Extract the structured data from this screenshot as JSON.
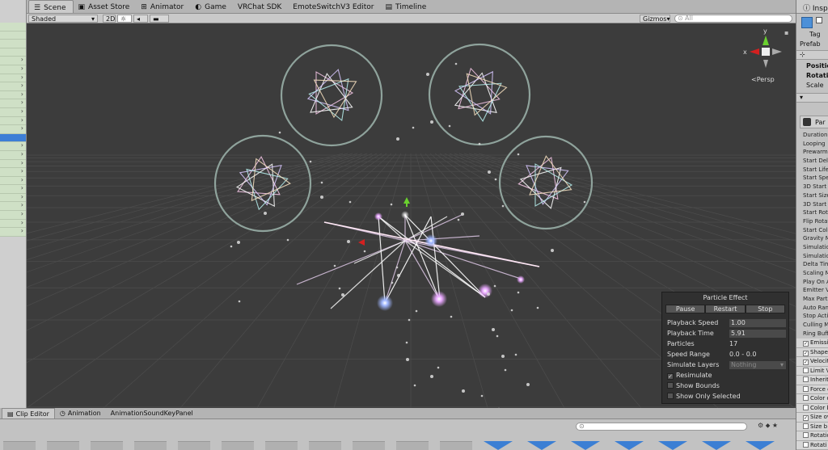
{
  "scene_tabs": [
    {
      "label": "Scene",
      "icon": "scene-icon",
      "active": true
    },
    {
      "label": "Asset Store",
      "icon": "store-icon"
    },
    {
      "label": "Animator",
      "icon": "animator-icon"
    },
    {
      "label": "Game",
      "icon": "game-icon"
    },
    {
      "label": "VRChat SDK"
    },
    {
      "label": "EmoteSwitchV3 Editor"
    },
    {
      "label": "Timeline",
      "icon": "timeline-icon"
    }
  ],
  "toolbar": {
    "shading_mode": "Shaded",
    "mode_2d": "2D",
    "gizmos_label": "Gizmos",
    "search_placeholder": "All"
  },
  "scene": {
    "persp_label": "Persp",
    "axis_x": "x",
    "axis_y": "y"
  },
  "inspector": {
    "tab_label": "Inspe",
    "tag_label": "Tag",
    "prefab_label": "Prefab",
    "transform_rows": [
      "Positio",
      "Rotati",
      "Scale"
    ],
    "component_label": "Par",
    "props": [
      "Duration",
      "Looping",
      "Prewarm",
      "Start Dela",
      "Start Life",
      "Start Spe",
      "3D Start S",
      "Start Size",
      "3D Start R",
      "Start Rota",
      "Flip Rotat",
      "Start Colo",
      "Gravity M",
      "Simulation",
      "Simulation",
      "Delta Tim",
      "Scaling M",
      "Play On A",
      "Emitter V",
      "Max Parti",
      "Auto Rand",
      "Stop Actio",
      "Culling M",
      "Ring Buffe"
    ],
    "modules": [
      {
        "label": "Emissio",
        "checked": true
      },
      {
        "label": "Shape",
        "checked": true
      },
      {
        "label": "Velocit",
        "checked": true
      },
      {
        "label": "Limit V",
        "checked": false
      },
      {
        "label": "Inherit",
        "checked": false
      },
      {
        "label": "Force o",
        "checked": false
      },
      {
        "label": "Color o",
        "checked": false
      },
      {
        "label": "Color b",
        "checked": false
      },
      {
        "label": "Size ov",
        "checked": true
      },
      {
        "label": "Size b",
        "checked": false
      },
      {
        "label": "Rotatio",
        "checked": false
      },
      {
        "label": "Rotati",
        "checked": false
      }
    ]
  },
  "particle_effect": {
    "title": "Particle Effect",
    "pause": "Pause",
    "restart": "Restart",
    "stop": "Stop",
    "playback_speed_label": "Playback Speed",
    "playback_speed": "1.00",
    "playback_time_label": "Playback Time",
    "playback_time": "5.91",
    "particles_label": "Particles",
    "particles": "17",
    "speed_range_label": "Speed Range",
    "speed_range": "0.0 - 0.0",
    "simulate_layers_label": "Simulate Layers",
    "simulate_layers": "Nothing",
    "resimulate_label": "Resimulate",
    "resimulate": true,
    "show_bounds_label": "Show Bounds",
    "show_bounds": false,
    "show_only_selected_label": "Show Only Selected",
    "show_only_selected": false
  },
  "bottom_tabs": [
    {
      "label": "Clip Editor",
      "icon": "clip-editor-icon",
      "active": true
    },
    {
      "label": "Animation",
      "icon": "clock-icon"
    },
    {
      "label": "AnimationSoundKeyPanel"
    }
  ],
  "colors": {
    "viewport_bg": "#3c3c3c",
    "selection": "#3d7ed6",
    "gizmo_y": "#6ad02e",
    "gizmo_x": "#d42020",
    "circle": "#8fa39c"
  }
}
